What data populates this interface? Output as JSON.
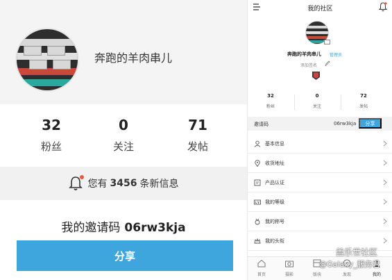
{
  "left": {
    "username": "奔跑的羊肉串儿",
    "stats": [
      {
        "value": "32",
        "label": "粉丝"
      },
      {
        "value": "0",
        "label": "关注"
      },
      {
        "value": "71",
        "label": "发帖"
      }
    ],
    "notice": {
      "prefix": "您有",
      "count": "3456",
      "suffix": "条新信息"
    },
    "invite": {
      "label": "我的邀请码",
      "code": "06rw3kja"
    },
    "share_label": "分享"
  },
  "right": {
    "title": "我的社区",
    "username": "奔跑的羊肉串儿",
    "role_badge": "管理员",
    "sign_placeholder": "添加签名",
    "stats": [
      {
        "value": "32",
        "label": "粉丝"
      },
      {
        "value": "0",
        "label": "关注"
      },
      {
        "value": "72",
        "label": "发帖"
      }
    ],
    "invite": {
      "label": "邀请码",
      "code": "06rw3kja",
      "share_label": "分享"
    },
    "menu": [
      {
        "icon": "user-icon",
        "label": "基本信息"
      },
      {
        "icon": "location-icon",
        "label": "收货地址"
      },
      {
        "icon": "certificate-icon",
        "label": "产品认证"
      },
      {
        "icon": "level-icon",
        "label": "我的等级"
      },
      {
        "icon": "medal-icon",
        "label": "我的称号"
      },
      {
        "icon": "headframe-icon",
        "label": "我的头衔"
      }
    ],
    "tabs": [
      {
        "icon": "home-icon",
        "label": "首页"
      },
      {
        "icon": "camera-icon",
        "label": "摄影"
      },
      {
        "icon": "board-icon",
        "label": "版块"
      },
      {
        "icon": "discover-icon",
        "label": "发现"
      },
      {
        "icon": "profile-icon",
        "label": "我的"
      }
    ]
  },
  "watermark": {
    "line1": "盖乐世社区",
    "line2": "@Galaxy_服务君"
  },
  "colors": {
    "accent": "#3fa5dd",
    "notice_dot": "#e85a3c"
  }
}
